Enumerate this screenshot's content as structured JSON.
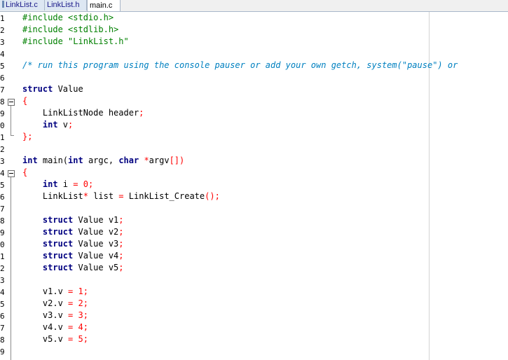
{
  "tabs": [
    {
      "label": "LinkList.c",
      "active": false
    },
    {
      "label": "LinkList.h",
      "active": false
    },
    {
      "label": "main.c",
      "active": true
    }
  ],
  "line_numbers": [
    "1",
    "2",
    "3",
    "4",
    "5",
    "6",
    "7",
    "8",
    "9",
    "0",
    "1",
    "2",
    "3",
    "4",
    "5",
    "6",
    "7",
    "8",
    "9",
    "0",
    "1",
    "2",
    "3",
    "4",
    "5",
    "6",
    "7",
    "8",
    "9"
  ],
  "colors": {
    "preprocessor": "#008000",
    "comment": "#0080c0",
    "keyword": "#000080",
    "operator": "#ff0000",
    "tab_inactive": "#dde7f3"
  },
  "code": {
    "l1": "#include <stdio.h>",
    "l2": "#include <stdlib.h>",
    "l3": "#include \"LinkList.h\"",
    "l5": "/* run this program using the console pauser or add your own getch, system(\"pause\") or",
    "l7_kw": "struct",
    "l7_name": " Value",
    "l8": "{",
    "l9_type": "    LinkListNode header",
    "l9_semi": ";",
    "l10_kw": "    int",
    "l10_v": " v",
    "l10_semi": ";",
    "l11": "};",
    "l13_kw": "int",
    "l13_main": " main(",
    "l13_kw2": "int",
    "l13_argc": " argc, ",
    "l13_kw3": "char",
    "l13_star": " *",
    "l13_argv": "argv",
    "l13_br": "[])",
    "l14": "{",
    "l15_kw": "    int",
    "l15_i": " i ",
    "l15_eq": "=",
    "l15_zero": " 0",
    "l15_semi": ";",
    "l16_type": "    LinkList",
    "l16_star": "*",
    "l16_list": " list ",
    "l16_eq": "=",
    "l16_call": " LinkList_Create",
    "l16_paren": "();",
    "struct_decls": [
      {
        "kw": "    struct",
        "text": " Value v1",
        "semi": ";"
      },
      {
        "kw": "    struct",
        "text": " Value v2",
        "semi": ";"
      },
      {
        "kw": "    struct",
        "text": " Value v3",
        "semi": ";"
      },
      {
        "kw": "    struct",
        "text": " Value v4",
        "semi": ";"
      },
      {
        "kw": "    struct",
        "text": " Value v5",
        "semi": ";"
      }
    ],
    "assigns": [
      {
        "lhs": "    v1.v ",
        "eq": "=",
        "num": " 1",
        "semi": ";"
      },
      {
        "lhs": "    v2.v ",
        "eq": "=",
        "num": " 2",
        "semi": ";"
      },
      {
        "lhs": "    v3.v ",
        "eq": "=",
        "num": " 3",
        "semi": ";"
      },
      {
        "lhs": "    v4.v ",
        "eq": "=",
        "num": " 4",
        "semi": ";"
      },
      {
        "lhs": "    v5.v ",
        "eq": "=",
        "num": " 5",
        "semi": ";"
      }
    ]
  }
}
